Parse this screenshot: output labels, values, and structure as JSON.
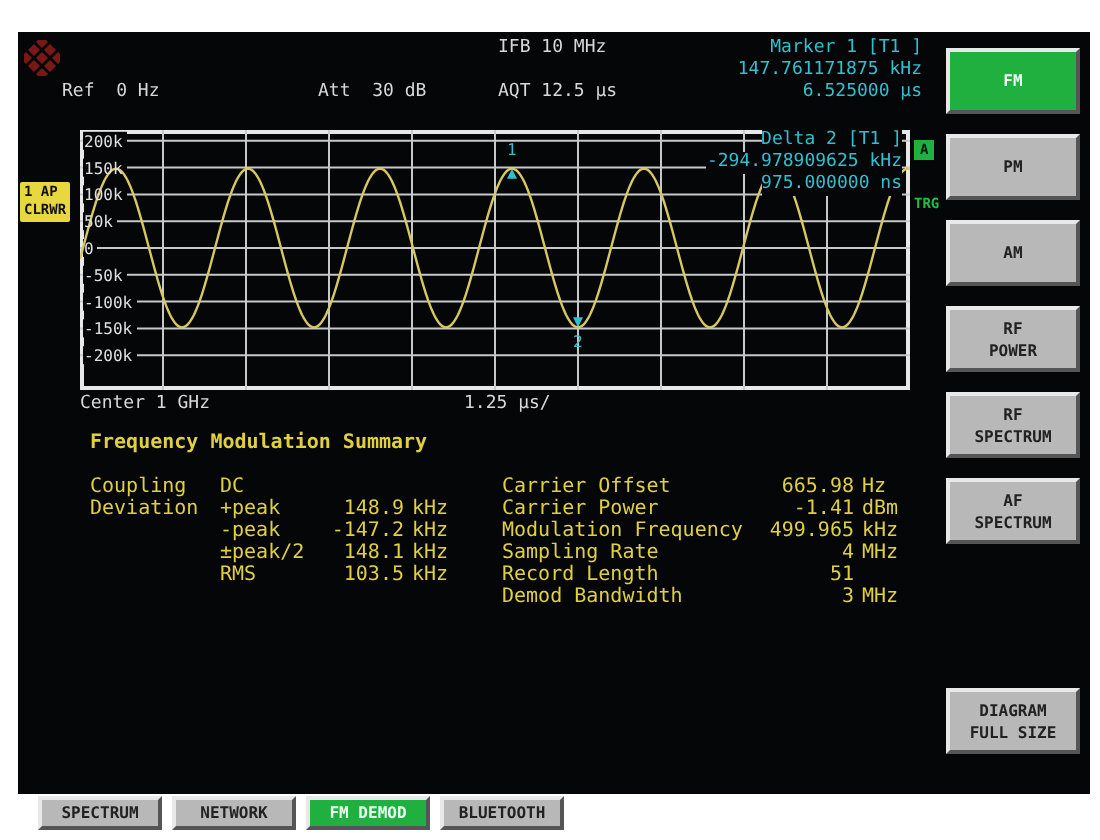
{
  "header": {
    "ifb": "IFB 10 MHz",
    "ref": "Ref  0 Hz",
    "att": "Att  30 dB",
    "aqt": "AQT 12.5 µs",
    "marker": [
      "Marker 1 [T1 ]",
      "147.761171875 kHz",
      "6.525000 µs"
    ]
  },
  "trace_badge": [
    "1 AP",
    "CLRWR"
  ],
  "channel_badge": "A",
  "trigger_label": "TRG",
  "plot": {
    "y_ticks": [
      "200k",
      "150k",
      "100k",
      "50k",
      "0",
      "-50k",
      "-100k",
      "-150k",
      "-200k"
    ],
    "markers": [
      {
        "label": "1"
      },
      {
        "label": "2"
      }
    ],
    "delta": [
      "Delta 2 [T1 ]",
      "-294.978909625 kHz",
      "975.000000 ns"
    ],
    "center": "Center 1 GHz",
    "scale": "1.25 µs/"
  },
  "summary": {
    "title": "Frequency Modulation Summary",
    "left_rows": [
      {
        "label": "Coupling",
        "item": "DC"
      },
      {
        "label": "Deviation",
        "item": "+peak",
        "value": "148.9",
        "unit": "kHz"
      },
      {
        "item": "-peak",
        "value": "-147.2",
        "unit": "kHz"
      },
      {
        "item": "±peak/2",
        "value": "148.1",
        "unit": "kHz"
      },
      {
        "item": "RMS",
        "value": "103.5",
        "unit": "kHz"
      }
    ],
    "right_rows": [
      {
        "label": "Carrier Offset",
        "value": "665.98",
        "unit": "Hz"
      },
      {
        "label": "Carrier Power",
        "value": "-1.41",
        "unit": "dBm"
      },
      {
        "label": "Modulation Frequency",
        "value": "499.965",
        "unit": "kHz"
      },
      {
        "label": "Sampling Rate",
        "value": "4",
        "unit": "MHz"
      },
      {
        "label": "Record Length",
        "value": "51"
      },
      {
        "label": "Demod Bandwidth",
        "value": "3",
        "unit": "MHz"
      }
    ]
  },
  "softkeys": [
    {
      "label": "FM",
      "selected": true
    },
    {
      "label": "PM",
      "selected": false
    },
    {
      "label": "AM",
      "selected": false
    },
    {
      "label": "RF\nPOWER",
      "selected": false
    },
    {
      "label": "RF\nSPECTRUM",
      "selected": false
    },
    {
      "label": "AF\nSPECTRUM",
      "selected": false
    }
  ],
  "diagram_key": {
    "label": "DIAGRAM\nFULL SIZE",
    "selected": false
  },
  "tabs": [
    {
      "label": "SPECTRUM",
      "selected": false
    },
    {
      "label": "NETWORK",
      "selected": false
    },
    {
      "label": "FM DEMOD",
      "selected": true
    },
    {
      "label": "BLUETOOTH",
      "selected": false
    }
  ]
}
